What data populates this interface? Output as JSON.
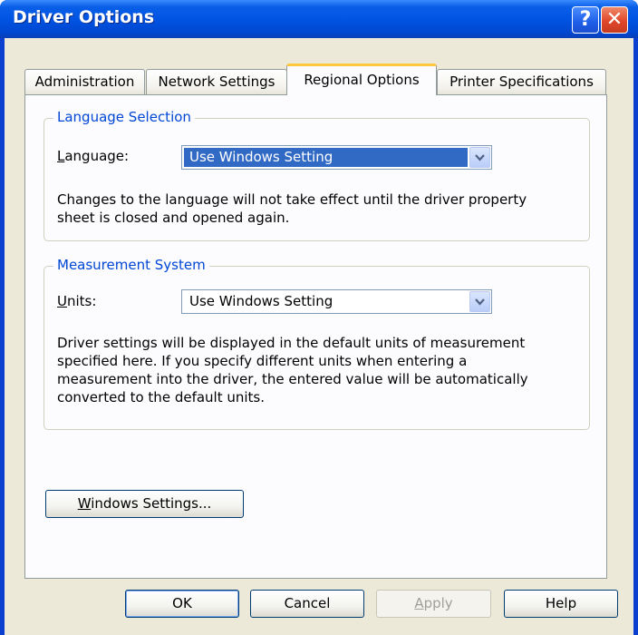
{
  "window": {
    "title": "Driver Options",
    "help_glyph": "?",
    "close_glyph": "✕"
  },
  "tabs": [
    {
      "label": "Administration"
    },
    {
      "label": "Network Settings"
    },
    {
      "label": "Regional Options",
      "active": true
    },
    {
      "label": "Printer Specifications"
    }
  ],
  "language_group": {
    "title": "Language Selection",
    "label_prefix": "",
    "label_hotkey": "L",
    "label_rest": "anguage:",
    "value": "Use Windows Setting",
    "desc_line1": "Changes to the language will not take effect until the driver property",
    "desc_line2": "sheet is closed and opened again."
  },
  "measurement_group": {
    "title": "Measurement System",
    "label_hotkey": "U",
    "label_rest": "nits:",
    "value": "Use Windows Setting",
    "desc_line1": "Driver settings will be displayed in the default units of measurement",
    "desc_line2": "specified here.  If you specify different units when entering a",
    "desc_line3": "measurement into the driver, the entered value will be automatically",
    "desc_line4": "converted to the default units."
  },
  "windows_settings_button": {
    "hotkey": "W",
    "rest": "indows Settings..."
  },
  "footer": {
    "ok": "OK",
    "cancel": "Cancel",
    "apply_hotkey": "A",
    "apply_rest": "pply",
    "help": "Help"
  },
  "colors": {
    "accent": "#0054e3",
    "group_title": "#0046d5",
    "selection": "#316ac5",
    "tab_highlight": "#ffc83c"
  }
}
